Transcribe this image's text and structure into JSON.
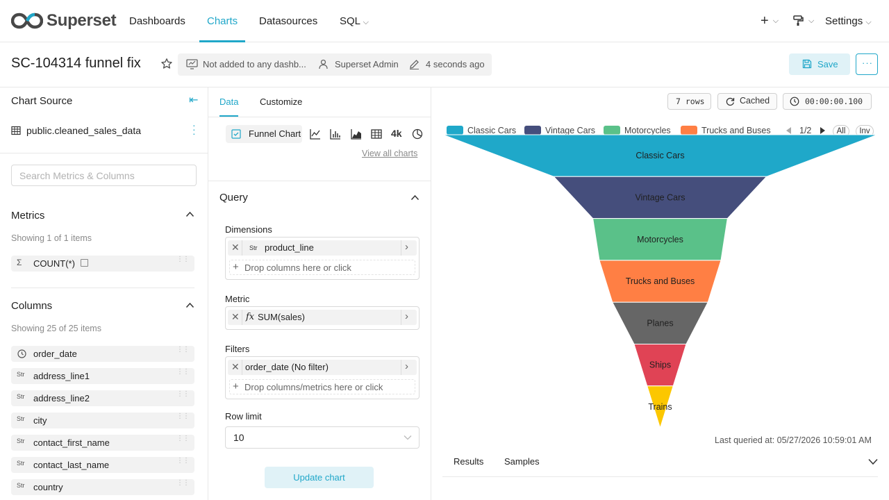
{
  "nav": {
    "logo_text": "Superset",
    "items": [
      "Dashboards",
      "Charts",
      "Datasources",
      "SQL"
    ],
    "settings_label": "Settings"
  },
  "titlebar": {
    "title": "SC-104314 funnel fix",
    "dashboards_text": "Not added to any dashb...",
    "owner": "Superset Admin",
    "modified": "4 seconds ago",
    "save_label": "Save"
  },
  "datasource": {
    "header": "Chart Source",
    "name": "public.cleaned_sales_data",
    "search_placeholder": "Search Metrics & Columns"
  },
  "metrics": {
    "header": "Metrics",
    "showing": "Showing 1 of 1 items",
    "items": [
      "COUNT(*)"
    ]
  },
  "columns": {
    "header": "Columns",
    "showing": "Showing 25 of 25 items",
    "items": [
      "order_date",
      "address_line1",
      "address_line2",
      "city",
      "contact_first_name",
      "contact_last_name",
      "country"
    ]
  },
  "tabs": {
    "data": "Data",
    "customize": "Customize"
  },
  "viz": {
    "selected": "Funnel Chart",
    "bignum_label": "4k",
    "view_all": "View all charts"
  },
  "query": {
    "header": "Query",
    "dimensions_label": "Dimensions",
    "dimension_value": "product_line",
    "dimension_type": "Str",
    "drop_columns": "Drop columns here or click",
    "metric_label": "Metric",
    "metric_value": "SUM(sales)",
    "metric_type": "fx",
    "filters_label": "Filters",
    "filter_value": "order_date (No filter)",
    "drop_filters": "Drop columns/metrics here or click",
    "row_limit_label": "Row limit",
    "row_limit_value": "10",
    "update_label": "Update chart"
  },
  "status": {
    "rows": "7 rows",
    "cached": "Cached",
    "timer": "00:00:00.100"
  },
  "legend": {
    "page": "1/2",
    "all": "All",
    "inv": "Inv"
  },
  "chart_data": {
    "type": "funnel",
    "categories": [
      "Classic Cars",
      "Vintage Cars",
      "Motorcycles",
      "Trucks and Buses",
      "Planes",
      "Ships",
      "Trains"
    ],
    "relative_widths": [
      1.0,
      0.49,
      0.31,
      0.28,
      0.22,
      0.12,
      0.06
    ],
    "colors": [
      "#1fa8c9",
      "#454e7c",
      "#5ac189",
      "#ff7f44",
      "#666666",
      "#e04355",
      "#fcc700"
    ],
    "legend_visible": [
      "Classic Cars",
      "Vintage Cars",
      "Motorcycles",
      "Trucks and Buses"
    ]
  },
  "footer": {
    "last_queried": "Last queried at: 05/27/2026 10:59:01 AM",
    "results_tab": "Results",
    "samples_tab": "Samples"
  }
}
